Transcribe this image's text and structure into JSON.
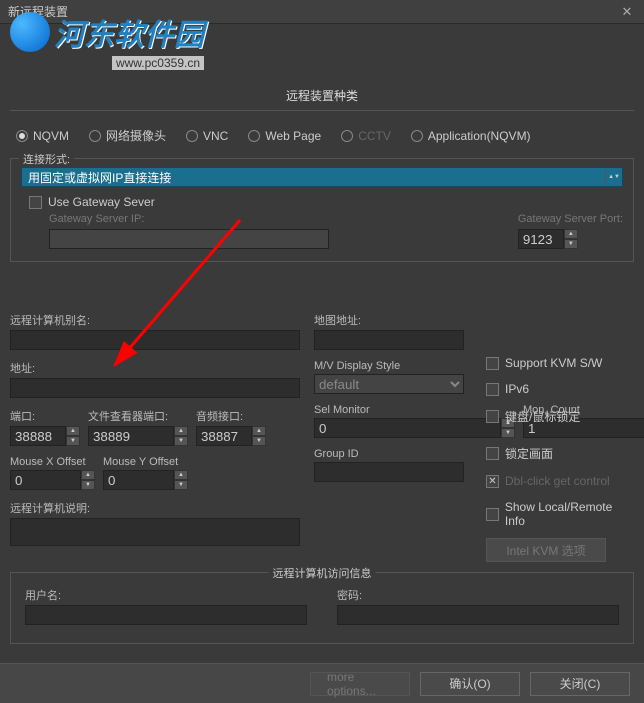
{
  "title": "新远程装置",
  "watermark": {
    "text": "河东软件园",
    "url": "www.pc0359.cn"
  },
  "section_device_type": "远程装置种类",
  "radios": {
    "nqvm": "NQVM",
    "webcam": "网络摄像头",
    "vnc": "VNC",
    "webpage": "Web Page",
    "cctv": "CCTV",
    "app": "Application(NQVM)"
  },
  "conn": {
    "label": "连接形式:",
    "value": "用固定或虚拟网IP直接连接",
    "use_gateway": "Use Gateway Sever",
    "gateway_ip": "Gateway Server IP:",
    "gateway_port": "Gateway Server Port:",
    "port_default": "9123"
  },
  "fields": {
    "alias": "远程计算机别名:",
    "address": "地址:",
    "port": "端口:",
    "file_port": "文件查看器端口:",
    "audio_port": "音频接口:",
    "mouse_x": "Mouse X Offset",
    "mouse_y": "Mouse Y Offset",
    "desc": "远程计算机说明:",
    "map_addr": "地图地址:",
    "mv_style": "M/V Display Style",
    "mv_default": "default",
    "sel_mon": "Sel Monitor",
    "mon_count": "Mon. Count",
    "group_id": "Group ID"
  },
  "vals": {
    "port": "38888",
    "file_port": "38889",
    "audio_port": "38887",
    "mx": "0",
    "my": "0",
    "sel_mon": "0",
    "mon_count": "1"
  },
  "checks": {
    "kvm": "Support KVM S/W",
    "ipv6": "IPv6",
    "lock_km": "键盘/鼠标锁定",
    "lock_screen": "锁定画面",
    "dblclick": "Dbl-click get control",
    "show_info": "Show Local/Remote Info"
  },
  "kvm_btn": "Intel KVM 选项",
  "access": {
    "title": "远程计算机访问信息",
    "user": "用户名:",
    "pass": "密码:"
  },
  "footer": {
    "more": "more options...",
    "ok": "确认(O)",
    "close": "关闭(C)"
  }
}
